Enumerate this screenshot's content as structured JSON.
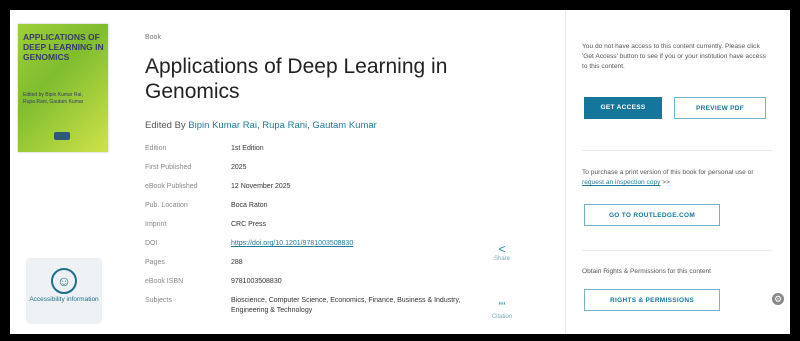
{
  "book": {
    "cover_title": "APPLICATIONS OF DEEP LEARNING IN GENOMICS",
    "cover_subtitle": "Edited by Bipin Kumar Rai, Rupa Rani, Gautam Kumar",
    "type": "Book",
    "title": "Applications of Deep Learning in Genomics",
    "editors_prefix": "Edited By",
    "editors": "Bipin Kumar Rai, Rupa Rani, Gautam Kumar"
  },
  "accessibility": {
    "label": "Accessibility information",
    "icon": "accessibility-icon"
  },
  "details": [
    {
      "label": "Edition",
      "value": "1st Edition"
    },
    {
      "label": "First Published",
      "value": "2025"
    },
    {
      "label": "eBook Published",
      "value": "12 November 2025"
    },
    {
      "label": "Pub. Location",
      "value": "Boca Raton"
    },
    {
      "label": "Imprint",
      "value": "CRC Press"
    },
    {
      "label": "DOI",
      "value": "https://doi.org/10.1201/9781003508830"
    },
    {
      "label": "Pages",
      "value": "288"
    },
    {
      "label": "eBook ISBN",
      "value": "9781003508830"
    },
    {
      "label": "Subjects",
      "value": "Bioscience, Computer Science, Economics, Finance, Business & Industry, Engineering & Technology"
    }
  ],
  "actions": {
    "share": {
      "icon": "share-icon",
      "label": "Share"
    },
    "citation": {
      "icon": "quote-icon",
      "label": "Citation"
    }
  },
  "access": {
    "text": "You do not have access to this content currently. Please click 'Get Access' button to see if you or your institution have access to this content.",
    "get_access": "GET ACCESS",
    "preview_pdf": "PREVIEW PDF"
  },
  "print": {
    "text_before": "To purchase a print version of this book for personal use or",
    "link": "request an inspection copy",
    "text_after": ">>",
    "button": "GO TO ROUTLEDGE.COM"
  },
  "rights": {
    "text": "Obtain Rights & Permissions for this content",
    "button": "RIGHTS & PERMISSIONS"
  },
  "colors": {
    "accent": "#15769b",
    "link": "#1f7a9a"
  }
}
